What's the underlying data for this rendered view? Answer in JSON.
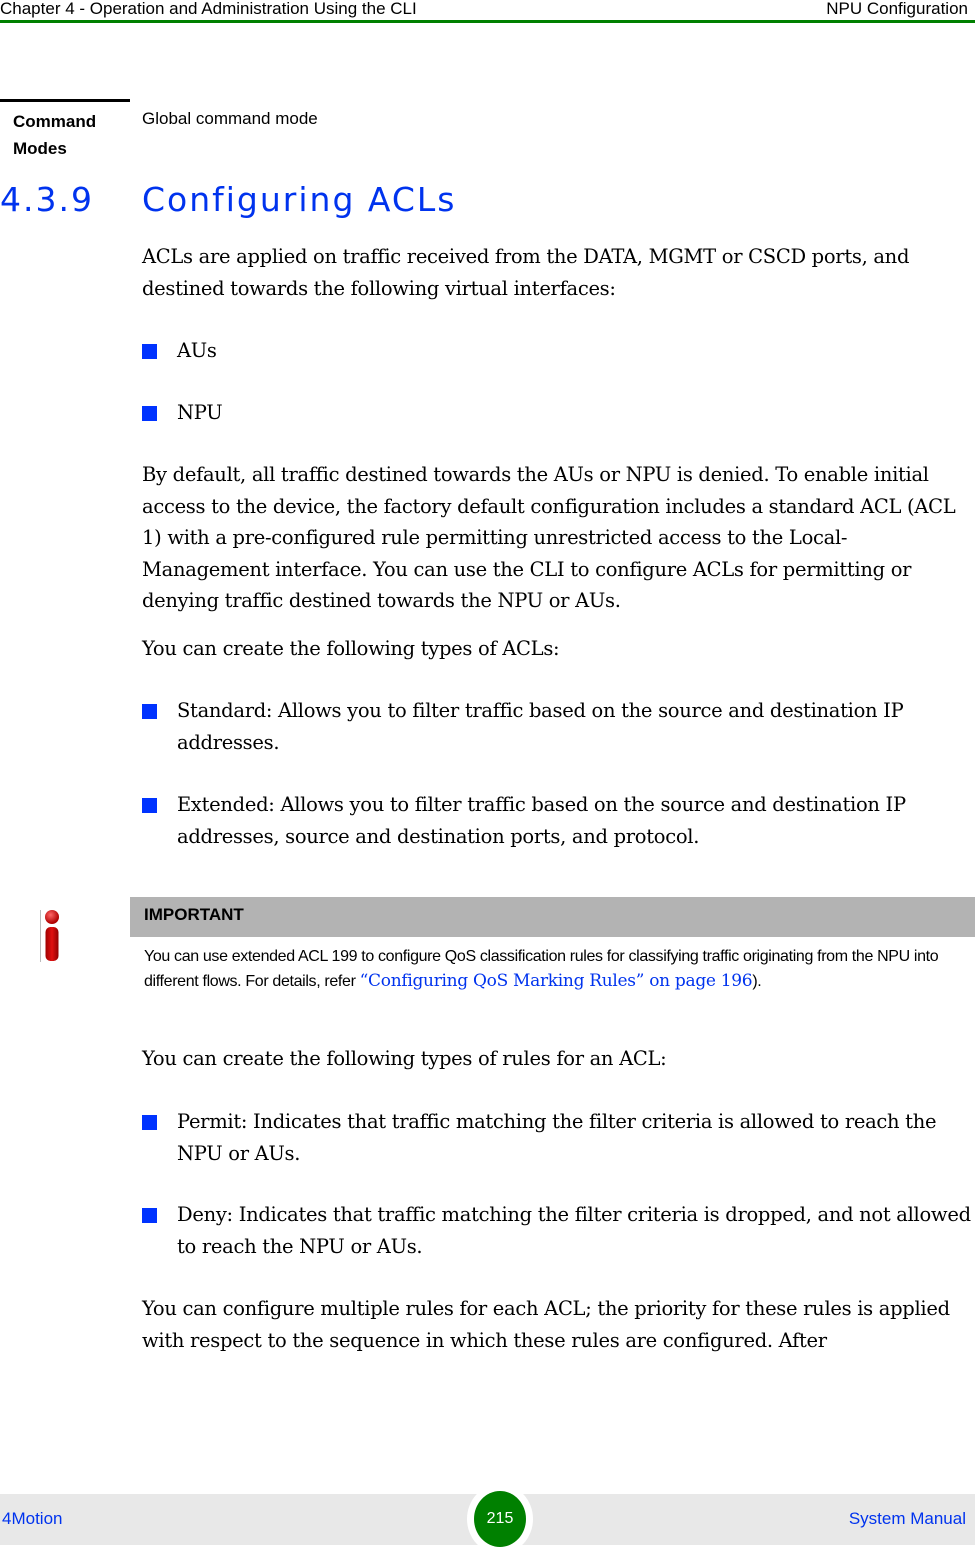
{
  "header": {
    "chapter": "Chapter 4 - Operation and Administration Using the CLI",
    "section": "NPU Configuration"
  },
  "command_modes": {
    "label": "Command Modes",
    "value": "Global command mode"
  },
  "section": {
    "number": "4.3.9",
    "title": "Configuring ACLs"
  },
  "body": {
    "intro": "ACLs are applied on traffic received from the DATA, MGMT or CSCD ports, and destined towards the following virtual interfaces:",
    "interfaces": [
      "AUs",
      "NPU"
    ],
    "default_para": "By default, all traffic destined towards the AUs or NPU is denied. To enable initial access to the device, the factory default configuration includes a standard ACL (ACL 1) with a pre-configured rule permitting unrestricted access to the Local-Management interface. You can use the CLI to configure ACLs for permitting or denying traffic destined towards the NPU or AUs.",
    "types_intro": "You can create the following types of ACLs:",
    "acl_types": [
      "Standard: Allows you to filter traffic based on the source and destination IP addresses.",
      "Extended: Allows you to filter traffic based on the source and destination IP addresses, source and destination ports, and protocol."
    ],
    "rules_intro": "You can create the following types of rules for an ACL:",
    "rule_types": [
      "Permit: Indicates that traffic matching the filter criteria is allowed to reach the NPU or AUs.",
      "Deny: Indicates that traffic matching the filter criteria is dropped, and not allowed to reach the NPU or AUs."
    ],
    "priority_para": "You can configure multiple rules for each ACL; the priority for these rules is applied with respect to the sequence in which these rules are configured. After"
  },
  "important": {
    "title": "IMPORTANT",
    "text_before": "You can use extended ACL 199 to configure QoS classification rules for classifying traffic originating from the NPU into different flows. For details, refer ",
    "link": "“Configuring QoS Marking Rules” on page 196",
    "text_after": ")."
  },
  "footer": {
    "product": "4Motion",
    "page": "215",
    "doc": "System Manual"
  },
  "colors": {
    "accent_green": "#008000",
    "heading_blue": "#0033ee",
    "bullet_blue": "#0033ff",
    "important_bar": "#b3b3b3"
  }
}
